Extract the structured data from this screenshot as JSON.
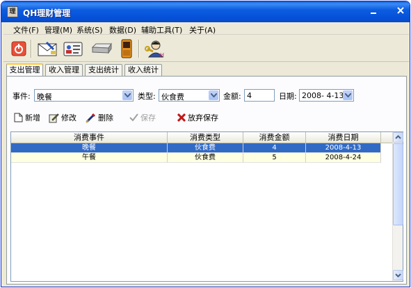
{
  "window": {
    "title": "QH理财管理",
    "app_icon": "理"
  },
  "menu": [
    "文件(F)",
    "管理(M)",
    "系统(S)",
    "数据(D)",
    "辅助工具(T)",
    "关于(A)"
  ],
  "toolbar_icons": [
    "power-icon",
    "send-letter-icon",
    "id-card-icon",
    "drive-icon",
    "phone-icon",
    "user-key-icon"
  ],
  "tabs": [
    {
      "label": "支出管理",
      "active": true
    },
    {
      "label": "收入管理",
      "active": false
    },
    {
      "label": "支出统计",
      "active": false
    },
    {
      "label": "收入统计",
      "active": false
    }
  ],
  "form": {
    "event_label": "事件:",
    "event_value": "晚餐",
    "type_label": "类型:",
    "type_value": "伙食费",
    "amount_label": "金额:",
    "amount_value": "4",
    "date_label": "日期:",
    "date_value": "2008- 4-13"
  },
  "actions": {
    "new": "新增",
    "edit": "修改",
    "delete": "删除",
    "save": "保存",
    "discard": "放弃保存"
  },
  "table": {
    "columns": [
      "消费事件",
      "消费类型",
      "消费金额",
      "消费日期"
    ],
    "rows": [
      {
        "event": "晚餐",
        "type": "伙食费",
        "amount": "4",
        "date": "2008-4-13"
      },
      {
        "event": "午餐",
        "type": "伙食费",
        "amount": "5",
        "date": "2008-4-24"
      }
    ]
  },
  "colors": {
    "titlebar": "#0451d8",
    "selection": "#316ac5",
    "row_alt": "#ffffe1",
    "tab_highlight": "#ffc83c"
  }
}
